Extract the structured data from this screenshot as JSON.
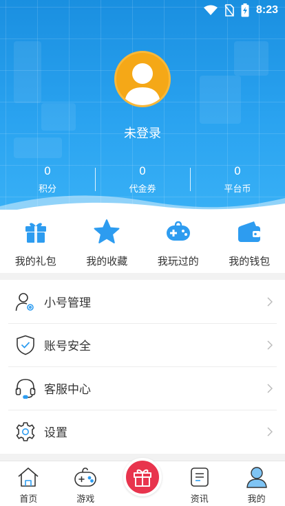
{
  "status_bar": {
    "time": "8:23",
    "icons": [
      "wifi-icon",
      "no-sim-icon",
      "battery-charging-icon"
    ]
  },
  "profile": {
    "login_text": "未登录",
    "avatar_icon": "default-avatar-icon"
  },
  "stats": [
    {
      "value": "0",
      "label": "积分"
    },
    {
      "value": "0",
      "label": "代金券"
    },
    {
      "value": "0",
      "label": "平台币"
    }
  ],
  "quick_actions": [
    {
      "label": "我的礼包",
      "icon": "gift-icon"
    },
    {
      "label": "我的收藏",
      "icon": "star-icon"
    },
    {
      "label": "我玩过的",
      "icon": "gamepad-icon"
    },
    {
      "label": "我的钱包",
      "icon": "wallet-icon"
    }
  ],
  "menu": [
    {
      "label": "小号管理",
      "icon": "user-settings-icon"
    },
    {
      "label": "账号安全",
      "icon": "shield-check-icon"
    },
    {
      "label": "客服中心",
      "icon": "headset-icon"
    },
    {
      "label": "设置",
      "icon": "gear-icon"
    }
  ],
  "bottom_nav": [
    {
      "label": "首页",
      "icon": "home-icon"
    },
    {
      "label": "游戏",
      "icon": "gamepad-outline-icon"
    },
    {
      "label": "",
      "icon": "gift-center-icon"
    },
    {
      "label": "资讯",
      "icon": "news-icon"
    },
    {
      "label": "我的",
      "icon": "user-icon"
    }
  ],
  "colors": {
    "header_blue": "#1a8fe0",
    "accent_blue": "#2d9cf0",
    "avatar_orange": "#f5a817",
    "center_button_red": "#e8344d"
  }
}
